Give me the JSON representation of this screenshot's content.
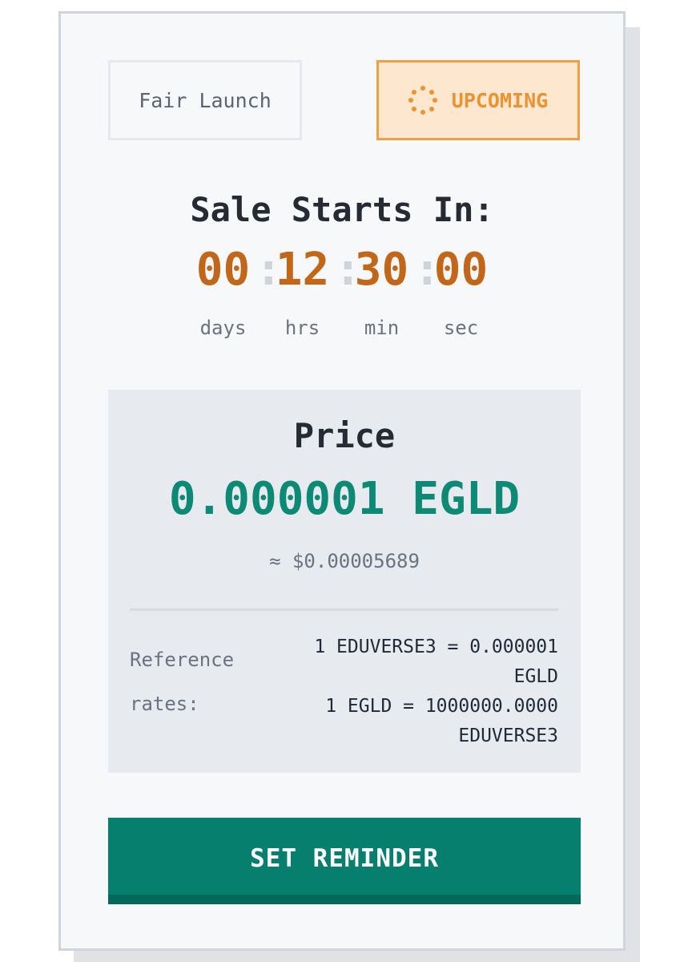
{
  "badges": {
    "sale_type": "Fair Launch",
    "status": "UPCOMING",
    "status_icon": "loading-spinner-icon"
  },
  "countdown": {
    "title": "Sale Starts In:",
    "units": [
      {
        "value": "00",
        "label": "days"
      },
      {
        "value": "12",
        "label": "hrs"
      },
      {
        "value": "30",
        "label": "min"
      },
      {
        "value": "00",
        "label": "sec"
      }
    ],
    "separator": ":"
  },
  "price": {
    "label": "Price",
    "value": "0.000001 EGLD",
    "usd_estimate": "≈ $0.00005689",
    "reference_label": "Reference rates:",
    "rates": [
      "1 EDUVERSE3 = 0.000001 EGLD",
      "1 EGLD = 1000000.0000 EDUVERSE3"
    ]
  },
  "actions": {
    "reminder_label": "SET REMINDER"
  },
  "colors": {
    "accent_orange": "#c2661a",
    "status_orange": "#ec9232",
    "status_bg": "#fde7cf",
    "price_green": "#0d8a76",
    "button_green": "#067f6e"
  }
}
